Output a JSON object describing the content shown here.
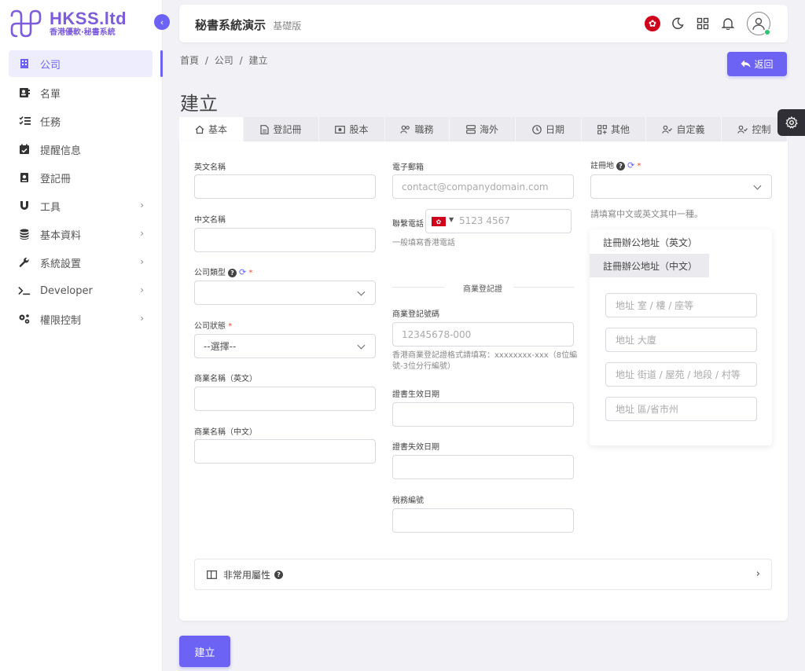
{
  "brand": {
    "title": "HKSS.ltd",
    "subtitle": "香港優軟·秘書系統",
    "color": "#7c5cdb"
  },
  "sidebar": {
    "items": [
      {
        "label": "公司",
        "icon": "building-icon",
        "active": true,
        "has_children": false
      },
      {
        "label": "名單",
        "icon": "contact-book-icon",
        "active": false,
        "has_children": false
      },
      {
        "label": "任務",
        "icon": "task-list-icon",
        "active": false,
        "has_children": false
      },
      {
        "label": "提醒信息",
        "icon": "calendar-check-icon",
        "active": false,
        "has_children": false
      },
      {
        "label": "登記冊",
        "icon": "register-book-icon",
        "active": false,
        "has_children": false
      },
      {
        "label": "工具",
        "icon": "magnet-icon",
        "active": false,
        "has_children": true
      },
      {
        "label": "基本資料",
        "icon": "database-icon",
        "active": false,
        "has_children": true
      },
      {
        "label": "系統設置",
        "icon": "wrench-icon",
        "active": false,
        "has_children": true
      },
      {
        "label": "Developer",
        "icon": "terminal-icon",
        "active": false,
        "has_children": true
      },
      {
        "label": "權限控制",
        "icon": "gears-icon",
        "active": false,
        "has_children": true
      }
    ]
  },
  "header": {
    "title": "秘書系統演示",
    "subtitle": "基礎版"
  },
  "breadcrumb": [
    "首頁",
    "/",
    "公司",
    "/",
    "建立"
  ],
  "back_button": "返回",
  "page_title": "建立",
  "tabs": [
    {
      "label": "基本",
      "icon": "home-icon"
    },
    {
      "label": "登記冊",
      "icon": "document-icon"
    },
    {
      "label": "股本",
      "icon": "cash-icon"
    },
    {
      "label": "職務",
      "icon": "users-icon"
    },
    {
      "label": "海外",
      "icon": "server-icon"
    },
    {
      "label": "日期",
      "icon": "clock-icon"
    },
    {
      "label": "其他",
      "icon": "grid-add-icon"
    },
    {
      "label": "自定義",
      "icon": "user-check-icon"
    },
    {
      "label": "控制",
      "icon": "user-check-icon"
    }
  ],
  "form": {
    "english_name_label": "英文名稱",
    "chinese_name_label": "中文名稱",
    "company_type_label": "公司類型",
    "company_status_label": "公司狀態",
    "company_status_value": "--選擇--",
    "business_name_en_label": "商業名稱（英文）",
    "business_name_zh_label": "商業名稱（中文）",
    "email_label": "電子郵箱",
    "email_placeholder": "contact@companydomain.com",
    "phone_label": "聯繫電話",
    "phone_placeholder": "5123 4567",
    "phone_hint": "一般填寫香港電話",
    "br_section_title": "商業登記證",
    "br_number_label": "商業登記號碼",
    "br_number_placeholder": "12345678-000",
    "br_hint_line1": "香港商業登記證格式請填寫：xxxxxxxx-xxx（8位編",
    "br_hint_line2": "號-3位分行編號）",
    "cert_start_label": "證書生效日期",
    "cert_end_label": "證書失效日期",
    "tax_number_label": "稅務編號",
    "reg_place_label": "註冊地",
    "reg_hint": "請填寫中文或英文其中一種。",
    "addr_tab_en": "註冊辦公地址（英文）",
    "addr_tab_zh": "註冊辦公地址（中文）",
    "addr_room_placeholder": "地址 室 / 樓 / 座等",
    "addr_building_placeholder": "地址 大廈",
    "addr_street_placeholder": "地址 街道 / 屋苑 / 地段 / 村等",
    "addr_district_placeholder": "地址 區/省市州"
  },
  "uncommon_props": "非常用屬性",
  "create_button": "建立",
  "colors": {
    "accent": "#6c63f5",
    "required": "#e74c3c",
    "online": "#28c76f"
  }
}
